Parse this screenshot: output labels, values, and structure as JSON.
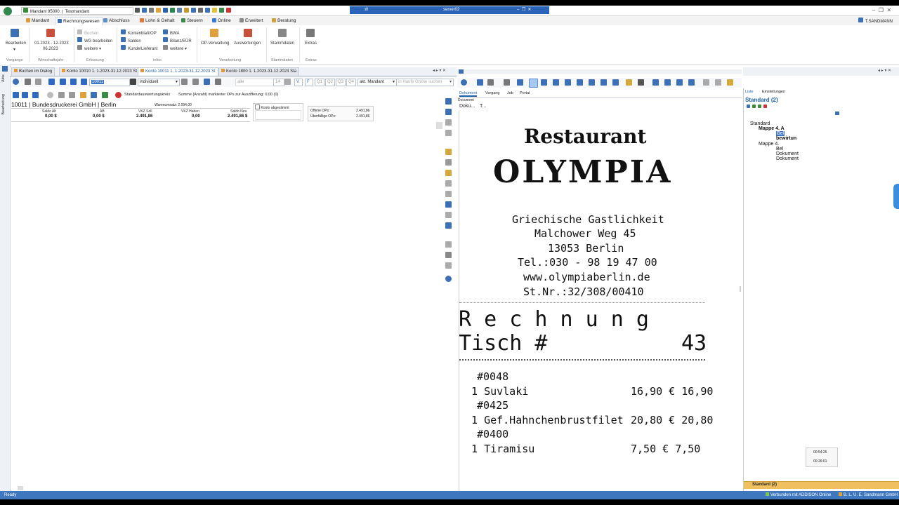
{
  "app": {
    "mandant": "Mandant 95000",
    "mandant_sep": "|",
    "testmandant": "Testmandant",
    "user": "T.SANDMANN"
  },
  "rdp": {
    "server": "server02"
  },
  "ribbon_tabs": [
    "Mandant",
    "Rechnungswesen",
    "Abschluss",
    "Lohn & Gehalt",
    "Steuern",
    "Online",
    "Erweitert",
    "Beratung"
  ],
  "ribbon": {
    "bearbeiten": "Bearbeiten",
    "vorgaenge": "Vorgänge",
    "period_range": "01.2023 - 12.2023",
    "period_month": "06.2023",
    "wirtschaftsjahr": "Wirtschaftsjahr",
    "buchen": "Buchen",
    "wg_bearbeiten": "WG bearbeiten",
    "weitere1": "weitere",
    "erfassung": "Erfassung",
    "kontenblatt": "Kontenblatt/OP",
    "salden": "Salden",
    "kunde_lieferant": "Kunde/Lieferant",
    "bwa": "BWA",
    "bilanz_eur": "Bilanz/EÜR",
    "weitere2": "weitere",
    "infos": "Infos",
    "op_verwaltung": "OP-Verwaltung",
    "auswertungen": "Auswertungen",
    "verarbeitung": "Verarbeitung",
    "stammdaten": "Stammdaten",
    "stammdaten_group": "Stammdaten",
    "extras": "Extras",
    "extras_group": "Extras"
  },
  "doc_tabs": [
    "Buchen im Dialog",
    "Konto 10010  1. 1.2023-31.12.2023 St",
    "Konto 10011  1. 1.2023-31.12.2023 St",
    "Konto 1800  1. 1.2023-31.12.2023 Sta"
  ],
  "left_strip": [
    "Akte",
    "Bearbeitung"
  ],
  "toolbar": {
    "account_field": "10011",
    "filter_mode": "individuell",
    "alle": "alle",
    "num14": "14",
    "v": "V",
    "f": "F",
    "q1": "Q1",
    "q2": "Q2",
    "q3": "Q3",
    "q4": "Q4",
    "akt_mandant": "akt. Mandant",
    "search_placeholder": "in Haufe Online suchen",
    "auswertungskreis": "Standardauswertungskreis",
    "summe": "Summe (Anzahl) markierter OPs zur Auszifferung: 0,00 (0)"
  },
  "account": {
    "title": "10011 | Bundesdruckerei GmbH | Berlin",
    "warenumsatz": "Warenumsatz: 2.094,00",
    "headers": [
      "Saldo Alt",
      "AB",
      "VKZ Soll",
      "VKZ Haben",
      "Saldo Neu"
    ],
    "values": [
      "0,00 $",
      "0,00 $",
      "2.491,86",
      "0,00",
      "2.491,86 $"
    ],
    "konto_abgestimmt": "Konto abgestimmt",
    "offene_ops_label": "Offene OPs:",
    "offene_ops": "2.491,86",
    "ueberfaellige_label": "Überfällige OPs:",
    "ueberfaellige": "2.491,86"
  },
  "doc_panel": {
    "tabs": [
      "Dokument",
      "Vorgang",
      "Job",
      "Portal"
    ],
    "document_label": "Document",
    "col1": "Doku...",
    "col2": "T..."
  },
  "receipt": {
    "line1": "Restaurant",
    "line2": "OLYMPIA",
    "line3": "Griechische Gastlichkeit",
    "line4": "Malchower Weg 45",
    "line5": "13053 Berlin",
    "line6": "Tel.:030 - 98 19 47 00",
    "line7": "www.olympiaberlin.de",
    "line8": "St.Nr.:32/308/00410",
    "rechnung": "R e c h n u n g",
    "tisch": "Tisch #",
    "tisch_nr": "43",
    "items": [
      {
        "code": "#0048",
        "qty": "1",
        "name": "Suvlaki",
        "price": "16,90 €",
        "total": "16,90"
      },
      {
        "code": "#0425",
        "qty": "1",
        "name": "Gef.Hahnchenbrustfilet",
        "price": "20,80 €",
        "total": "20,80"
      },
      {
        "code": "#0400",
        "qty": "1",
        "name": "Tiramisu",
        "price": "7,50 €",
        "total": "7,50"
      }
    ]
  },
  "tree_panel": {
    "tabs": [
      "Liste",
      "Einstellungen"
    ],
    "title": "Standard (2)",
    "root": "Standard",
    "mappe1": "Mappe 4. A",
    "bel1": "Bel",
    "bewirtung": "bewirtun",
    "mappe2": "Mappe 4.",
    "bel2": "Bel",
    "dok1": "Dokument",
    "dok2": "Dokument",
    "time1": "00:54:25",
    "time2": "00:26:01",
    "footer": "Standard (2)"
  },
  "status": {
    "ready": "Ready",
    "connected": "Verbunden mit ADDISON Online",
    "company": "B. L. U. E. Sandmann GmbH"
  },
  "colors": {
    "accent": "#3f77bf",
    "tab_active_text": "#1c5fa8",
    "rdp_bar": "#2a63b8"
  }
}
